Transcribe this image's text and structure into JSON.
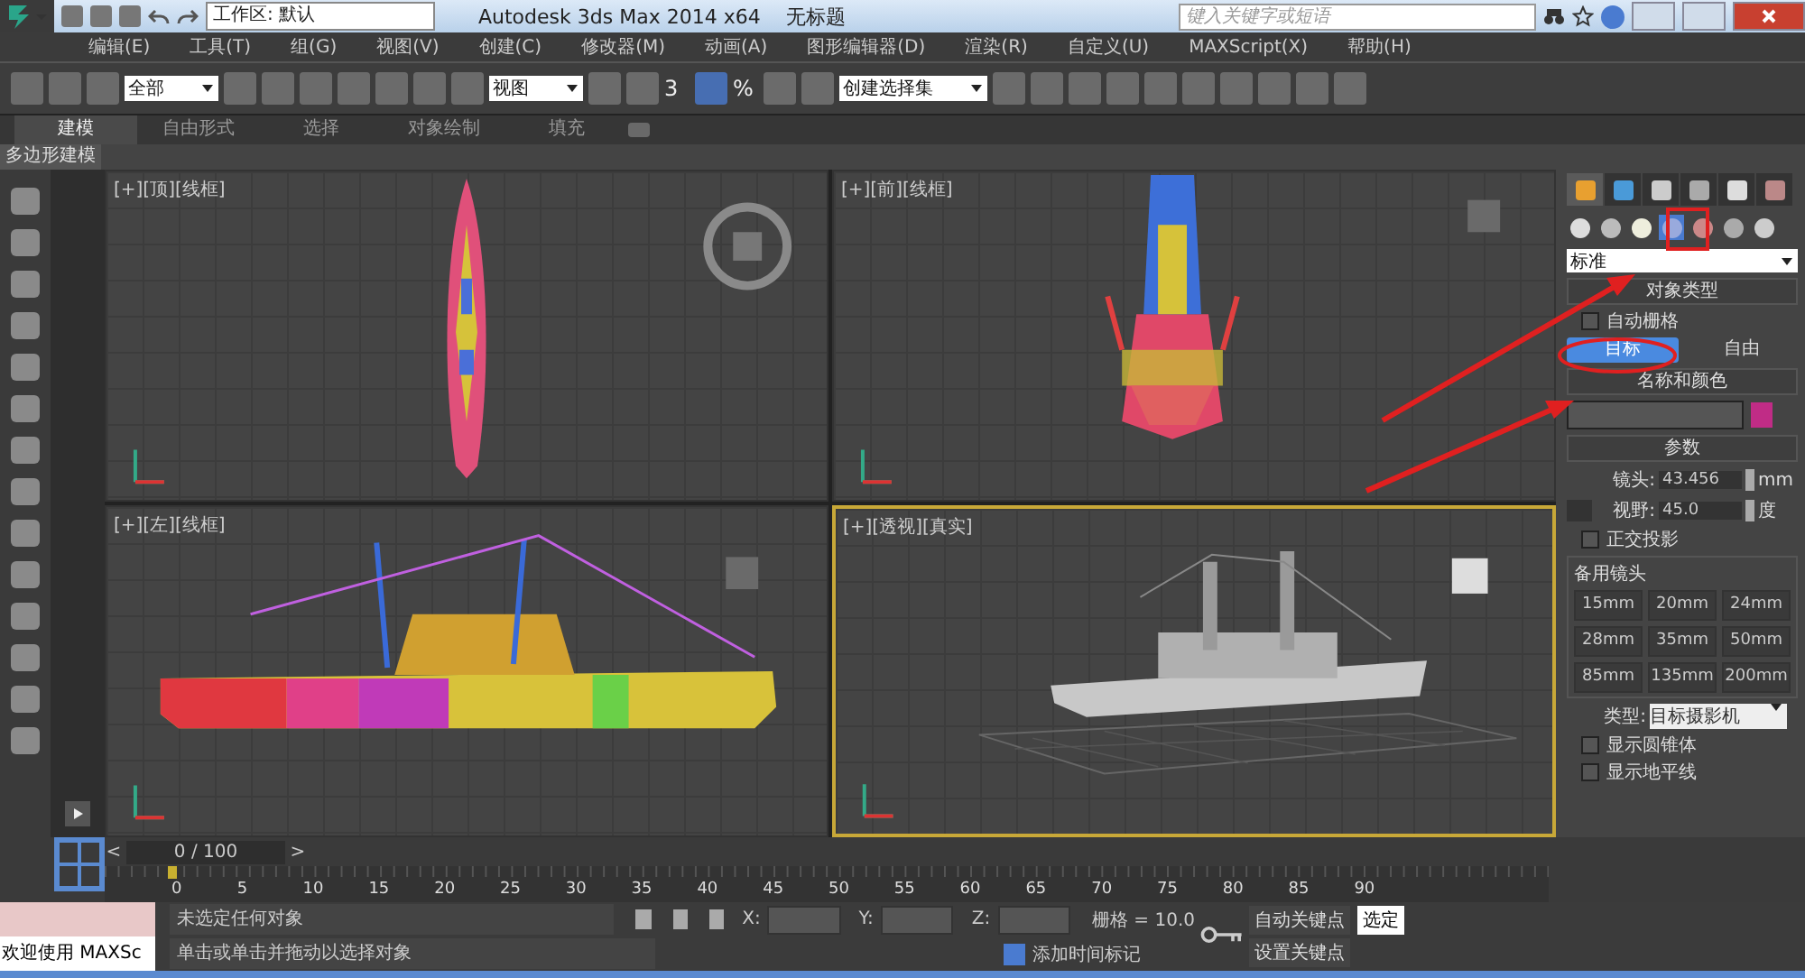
{
  "title_bar": {
    "workspace": "工作区: 默认",
    "app_title": "Autodesk 3ds Max  2014 x64",
    "document": "无标题",
    "search": {
      "placeholder": "键入关键字或短语"
    }
  },
  "menu": [
    "编辑(E)",
    "工具(T)",
    "组(G)",
    "视图(V)",
    "创建(C)",
    "修改器(M)",
    "动画(A)",
    "图形编辑器(D)",
    "渲染(R)",
    "自定义(U)",
    "MAXScript(X)",
    "帮助(H)"
  ],
  "toolbar": {
    "selection_filter": "全部",
    "reference_coord": "视图",
    "snap_label": "3",
    "percent_label": "%",
    "named_selection": "创建选择集"
  },
  "ribbon": {
    "tabs": [
      {
        "label": "建模",
        "selected": true
      },
      {
        "label": "自由形式",
        "selected": false
      },
      {
        "label": "选择",
        "selected": false
      },
      {
        "label": "对象绘制",
        "selected": false
      },
      {
        "label": "填充",
        "selected": false
      }
    ],
    "panel_label": "多边形建模"
  },
  "viewports": [
    {
      "kind": "top",
      "label": "[+][顶][线框]",
      "active": false
    },
    {
      "kind": "front",
      "label": "[+][前][线框]",
      "active": false
    },
    {
      "kind": "left",
      "label": "[+][左][线框]",
      "active": false
    },
    {
      "kind": "perspective",
      "label": "[+][透视][真实]",
      "active": true
    }
  ],
  "command_panel": {
    "tabs": [
      {
        "kind": "create",
        "selected": true
      },
      {
        "kind": "modify",
        "selected": false
      },
      {
        "kind": "hierarchy",
        "selected": false
      },
      {
        "kind": "motion",
        "selected": false
      },
      {
        "kind": "display",
        "selected": false
      },
      {
        "kind": "utilities",
        "selected": false
      }
    ],
    "categories": [
      {
        "kind": "geometry",
        "selected": false
      },
      {
        "kind": "shapes",
        "selected": false
      },
      {
        "kind": "lights",
        "selected": false
      },
      {
        "kind": "cameras",
        "selected": true
      },
      {
        "kind": "helpers",
        "selected": false
      },
      {
        "kind": "spacewarps",
        "selected": false
      },
      {
        "kind": "systems",
        "selected": false
      }
    ],
    "subcategory": "标准",
    "object_type": {
      "title": "对象类型",
      "autogrid": {
        "label": "自动栅格",
        "checked": false
      },
      "buttons": [
        {
          "label": "目标",
          "selected": true
        },
        {
          "label": "自由",
          "selected": false
        }
      ]
    },
    "name_color": {
      "title": "名称和颜色",
      "color": "#c02c86"
    },
    "parameters": {
      "title": "参数",
      "lens": {
        "label": "镜头:",
        "value": "43.456",
        "unit": "mm"
      },
      "fov": {
        "label": "视野:",
        "value": "45.0",
        "unit": "度"
      },
      "ortho": {
        "label": "正交投影",
        "checked": false
      },
      "stock_title": "备用镜头",
      "stock_lenses": [
        "15mm",
        "20mm",
        "24mm",
        "28mm",
        "35mm",
        "50mm",
        "85mm",
        "135mm",
        "200mm"
      ],
      "type": {
        "label": "类型:",
        "value": "目标摄影机"
      },
      "options": [
        {
          "label": "显示圆锥体",
          "checked": false
        },
        {
          "label": "显示地平线",
          "checked": false
        }
      ]
    }
  },
  "timeline": {
    "frame": "0 / 100",
    "prev": "<",
    "next": ">",
    "ticks": [
      "0",
      "5",
      "10",
      "15",
      "20",
      "25",
      "30",
      "35",
      "40",
      "45",
      "50",
      "55",
      "60",
      "65",
      "70",
      "75",
      "80",
      "85",
      "90"
    ]
  },
  "status": {
    "maxscript": "欢迎使用 MAXSc",
    "selection": "未选定任何对象",
    "prompt": "单击或单击并拖动以选择对象",
    "coords": [
      "X:",
      "Y:",
      "Z:"
    ],
    "grid": "栅格 = 10.0",
    "add_time_tag": "添加时间标记",
    "auto_key": "自动关键点",
    "set_key": "设置关键点",
    "key_filter": "选定"
  }
}
